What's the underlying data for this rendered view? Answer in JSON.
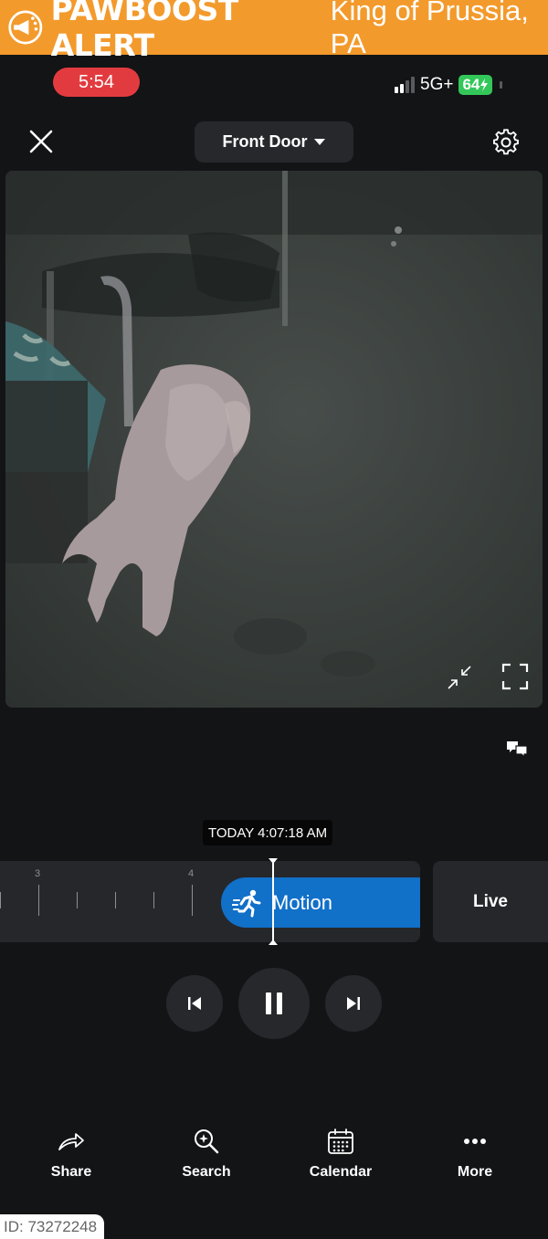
{
  "banner": {
    "title": "PAWBOOST ALERT",
    "location": "King of Prussia, PA",
    "color": "#f39a2c"
  },
  "status_bar": {
    "time": "5:54",
    "network": "5G+",
    "battery": "64"
  },
  "header": {
    "device_name": "Front Door"
  },
  "timeline": {
    "timestamp": "TODAY 4:07:18 AM",
    "tick_labels": [
      "3",
      "4"
    ],
    "event_label": "Motion",
    "live_label": "Live",
    "event_color": "#1170c8"
  },
  "nav": {
    "items": [
      {
        "label": "Share",
        "icon": "share-arrow-icon"
      },
      {
        "label": "Search",
        "icon": "search-sparkle-icon"
      },
      {
        "label": "Calendar",
        "icon": "calendar-icon"
      },
      {
        "label": "More",
        "icon": "more-dots-icon"
      }
    ]
  },
  "watermark": {
    "id_text": "ID: 73272248"
  }
}
